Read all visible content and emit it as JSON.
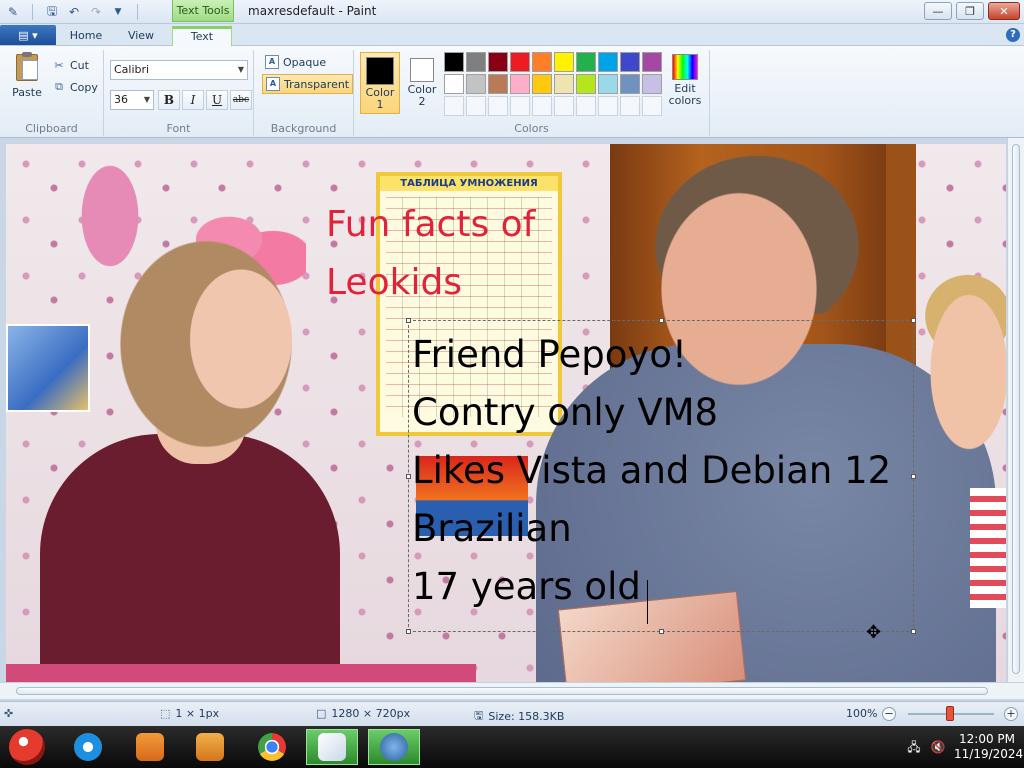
{
  "window": {
    "title": "maxresdefault - Paint",
    "context_tab_group": "Text Tools",
    "controls": {
      "minimize": "—",
      "maximize": "❐",
      "close": "✕"
    }
  },
  "quick_access": {
    "save_icon": "save-icon",
    "undo_icon": "undo-icon",
    "redo_icon": "redo-icon",
    "customize_icon": "chevron-down-icon"
  },
  "tabs": [
    {
      "label": "Home",
      "active": false
    },
    {
      "label": "View",
      "active": false
    },
    {
      "label": "Text",
      "active": true
    }
  ],
  "help": "?",
  "ribbon": {
    "clipboard": {
      "paste": "Paste",
      "cut": "Cut",
      "copy": "Copy",
      "label": "Clipboard"
    },
    "font": {
      "family": "Calibri",
      "size": "36",
      "bold": "B",
      "italic": "I",
      "underline": "U",
      "strikethrough": "abc",
      "label": "Font"
    },
    "background": {
      "opaque": "Opaque",
      "transparent": "Transparent",
      "selected": "Transparent",
      "label": "Background"
    },
    "colors": {
      "color1_label": "Color\n1",
      "color1_line1": "Color",
      "color1_line2": "1",
      "color2_line1": "Color",
      "color2_line2": "2",
      "color1": "#000000",
      "color2": "#ffffff",
      "palette_row1": [
        "#000000",
        "#7f7f7f",
        "#880015",
        "#ed1c24",
        "#ff7f27",
        "#fff200",
        "#22b14c",
        "#00a2e8",
        "#3f48cc",
        "#a349a4"
      ],
      "palette_row2": [
        "#ffffff",
        "#c3c3c3",
        "#b97a57",
        "#ffaec9",
        "#ffc90e",
        "#efe4b0",
        "#b5e61d",
        "#99d9ea",
        "#7092be",
        "#c8bfe7"
      ],
      "edit_line1": "Edit",
      "edit_line2": "colors",
      "label": "Colors"
    }
  },
  "canvas": {
    "overlay_title": "Fun facts of\nLeokids",
    "poster_title": "ТАБЛИЦА УМНОЖЕНИЯ",
    "text_lines": [
      "Friend Pepoyo!",
      "Contry only VM8",
      "Likes Vista and Debian 12",
      "Brazilian",
      "17 years old"
    ],
    "title_color": "#e0223a",
    "text_color": "#000000"
  },
  "statusbar": {
    "selection": "1 × 1px",
    "image_size": "1280 × 720px",
    "file_size": "Size: 158.3KB",
    "zoom": "100%"
  },
  "taskbar": {
    "apps": [
      "internet-explorer-icon",
      "file-explorer-icon",
      "media-player-icon",
      "chrome-icon",
      "paint-icon",
      "vmware-icon"
    ],
    "time": "12:00 PM",
    "date": "11/19/2024"
  }
}
